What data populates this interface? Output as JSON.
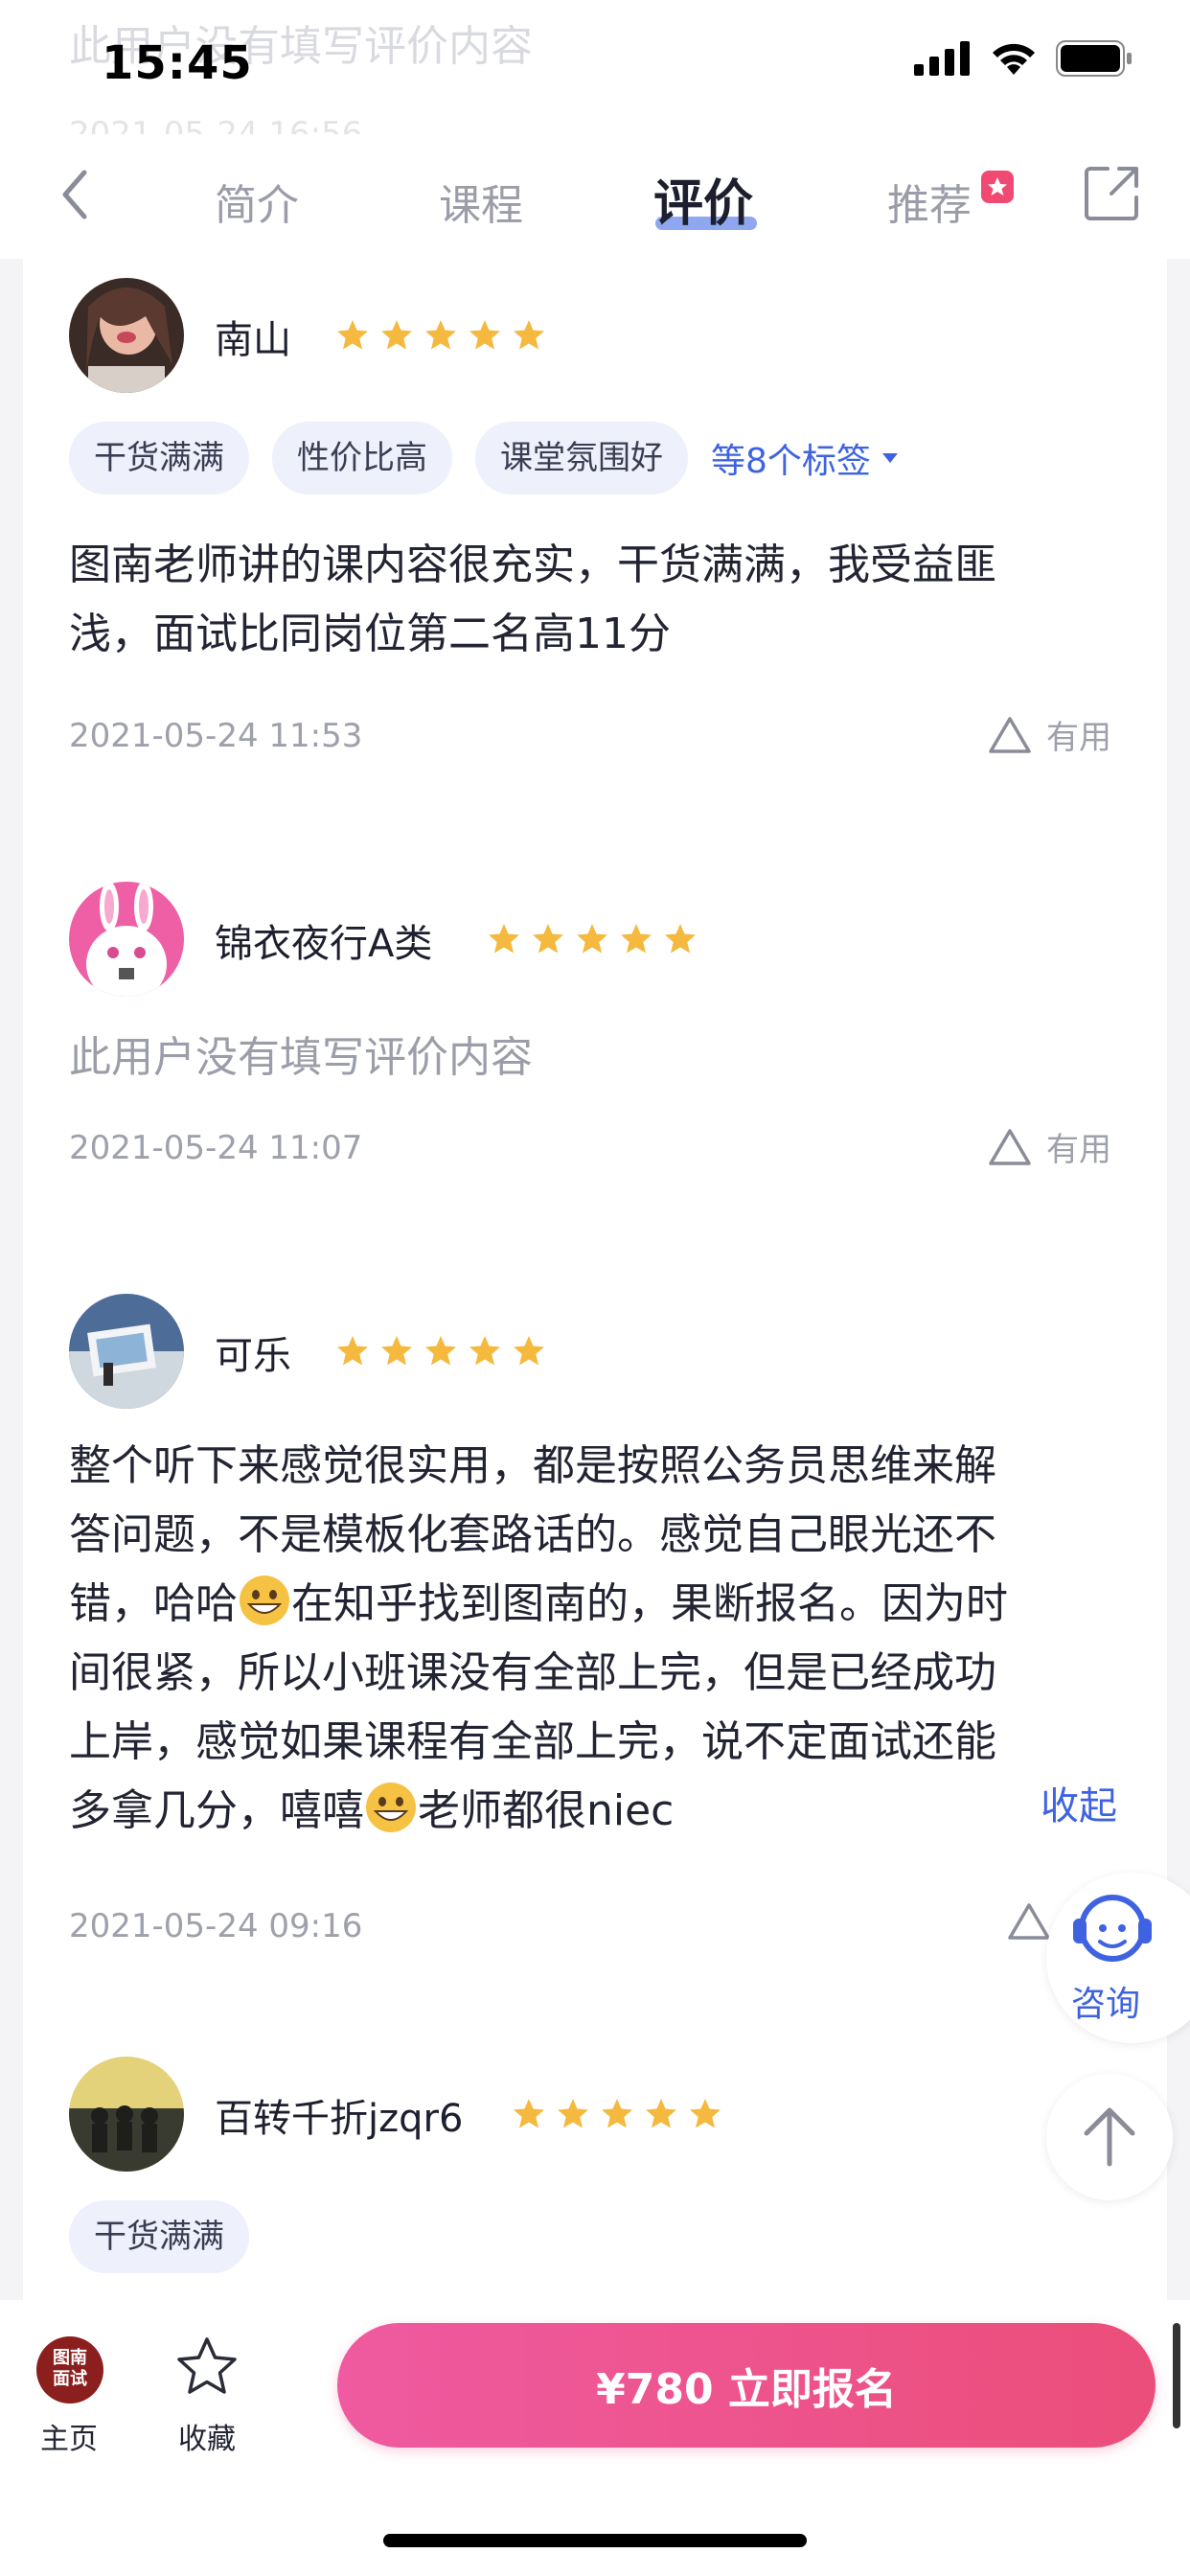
{
  "status_bar": {
    "time": "15:45",
    "ghost_text": "此用户没有填写评价内容",
    "ghost_date": "2021-05-24 16:56"
  },
  "nav": {
    "tabs": [
      {
        "label": "简介"
      },
      {
        "label": "课程"
      },
      {
        "label": "评价",
        "active": true
      },
      {
        "label": "推荐"
      }
    ]
  },
  "useful_label": "有用",
  "reviews": [
    {
      "user": "南山",
      "stars": 5,
      "tags": [
        "干货满满",
        "性价比高",
        "课堂氛围好"
      ],
      "more_tags": "等8个标签",
      "content_lines": [
        "图南老师讲的课内容很充实，干货满满，我受益匪",
        "浅，面试比同岗位第二名高11分"
      ],
      "date": "2021-05-24 11:53"
    },
    {
      "user": "锦衣夜行A类",
      "stars": 5,
      "content": "此用户没有填写评价内容",
      "date": "2021-05-24 11:07"
    },
    {
      "user": "可乐",
      "stars": 5,
      "content_lines": [
        "整个听下来感觉很实用，都是按照公务员思维来解",
        "答问题，不是模板化套路话的。感觉自己眼光还不",
        "错，哈哈",
        "在知乎找到图南的，果断报名。因为时",
        "间很紧，所以小班课没有全部上完，但是已经成功",
        "上岸，感觉如果课程有全部上完，说不定面试还能",
        "多拿几分，嘻嘻",
        "老师都很niec"
      ],
      "collapse_label": "收起",
      "date": "2021-05-24 09:16"
    },
    {
      "user": "百转千折jzqr6",
      "stars": 5,
      "tags": [
        "干货满满"
      ]
    }
  ],
  "float": {
    "consult_label": "咨询"
  },
  "bottom": {
    "logo_line1": "图南",
    "logo_line2": "面试",
    "home_label": "主页",
    "fav_label": "收藏",
    "signup_label": "¥780  立即报名"
  },
  "colors": {
    "accent_blue": "#3f63e0",
    "star_gold": "#f4b93e",
    "signup_pink": "#ec4e7a"
  }
}
